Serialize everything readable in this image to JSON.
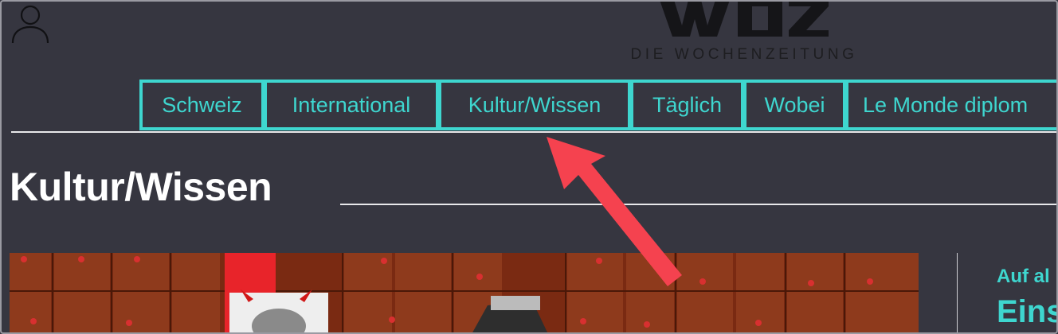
{
  "logo": {
    "subtitle": "DIE WOCHENZEITUNG",
    "alt": "WOZ"
  },
  "nav": {
    "items": [
      {
        "label": "Schweiz"
      },
      {
        "label": "International"
      },
      {
        "label": "Kultur/Wissen"
      },
      {
        "label": "Täglich"
      },
      {
        "label": "Wobei"
      },
      {
        "label": "Le Monde diplom"
      }
    ]
  },
  "page": {
    "title": "Kultur/Wissen"
  },
  "sidebar": {
    "kicker": "Auf al",
    "headline": "Eins"
  },
  "colors": {
    "accent": "#3ed6cf",
    "background": "#363640",
    "annotation": "#f5424f"
  },
  "icons": {
    "user": "user-icon"
  }
}
